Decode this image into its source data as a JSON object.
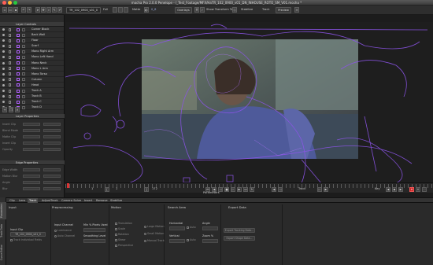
{
  "window": {
    "title": "mocha Pro 2.0.0 Penelope - /_Test_Footage/MFX/HaTR_102_0900_v01_DN_INHOUSE_ROTO_SM_V01.mocha *",
    "traffic_lights": [
      "#ff5f57",
      "#febc2e",
      "#28c840"
    ]
  },
  "toolbar": {
    "clip_name": "TR_102_0900_v01_0",
    "clip_mode": "Full",
    "view_label": "Matte",
    "layer_label": "0_8",
    "overlays_label": "Overlays",
    "show_transform_label": "Show Transform Tool",
    "stabilize_label": "Stabilize",
    "track_label": "Track",
    "preview_label": "Preview"
  },
  "layer_controls": {
    "header": "Layer Controls",
    "layers": [
      "Corner Block",
      "Back Wall",
      "Floor",
      "Scarf",
      "Mono Right Arm",
      "Mono Left Hand",
      "Mono Neck",
      "Mono L Arm",
      "Mono Torso",
      "Column",
      "Head",
      "Track A",
      "Track B",
      "Track C",
      "Track D"
    ]
  },
  "layer_properties": {
    "header": "Layer Properties",
    "rows": [
      "Insert Clip",
      "Blend Mode",
      "Matte Clip",
      "Insert Clip",
      "Opacity"
    ]
  },
  "edge_properties": {
    "header": "Edge Properties",
    "rows": [
      "Edge Width",
      "Motion Blur",
      "Angle",
      "Blur"
    ]
  },
  "timeline": {
    "frame_in": "1",
    "frame_current": "1",
    "frame_out": "172",
    "label_parameters": "Parameters",
    "label_track": "Track",
    "label_key": "Key",
    "key_badge": "A"
  },
  "param_tabs": [
    "Clip",
    "Lens",
    "Track",
    "AdjustTrack",
    "Camera Solve",
    "Insert",
    "Remove",
    "Stabilize"
  ],
  "param_tabs_active": 2,
  "side_tabs": [
    "Parameters",
    "Track Data",
    "Curve Editor"
  ],
  "track_params": {
    "input": "Input",
    "input_clip": "Input Clip",
    "input_clip_value": "TR_102_0900_v01_0",
    "track_individual": "Track Individual Fields",
    "preprocessing": "Preprocessing",
    "input_channel": "Input Channel",
    "channel_options": [
      "Luminance",
      "Auto Channel"
    ],
    "min_pixels": "Min % Pixels Used",
    "smoothing": "Smoothing Level",
    "motion": "Motion",
    "motion_options": [
      "Translation",
      "Scale",
      "Rotation",
      "Shear",
      "Perspective"
    ],
    "search_area": "Search Area",
    "search_options": [
      "Large Motion",
      "Small Motion",
      "Manual Track"
    ],
    "horizontal": "Horizontal",
    "vertical": "Vertical",
    "auto": "Auto",
    "angle": "Angle",
    "zoom": "Zoom %",
    "export_data": "Export Data",
    "export_buttons": [
      "Export Tracking Data...",
      "Export Shape Data..."
    ]
  }
}
